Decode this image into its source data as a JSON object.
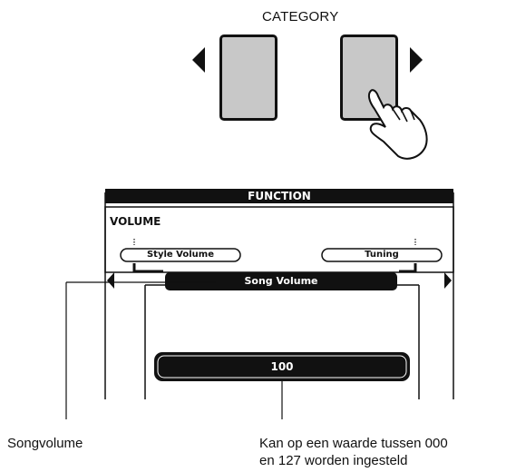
{
  "buttons": {
    "category_label": "CATEGORY"
  },
  "lcd": {
    "header": "FUNCTION",
    "section": "VOLUME",
    "left_item": "Style Volume",
    "right_item": "Tuning",
    "selected_item": "Song Volume",
    "value": "100"
  },
  "callouts": {
    "left": "Songvolume",
    "right_line1": "Kan op een waarde tussen 000",
    "right_line2": "en 127 worden ingesteld"
  },
  "colors": {
    "button_fill": "#c8c8c8",
    "lcd_dark": "#111111",
    "line": "#111111"
  },
  "icons": [
    "triangle-left-icon",
    "triangle-right-icon",
    "pressing-hand-icon"
  ]
}
